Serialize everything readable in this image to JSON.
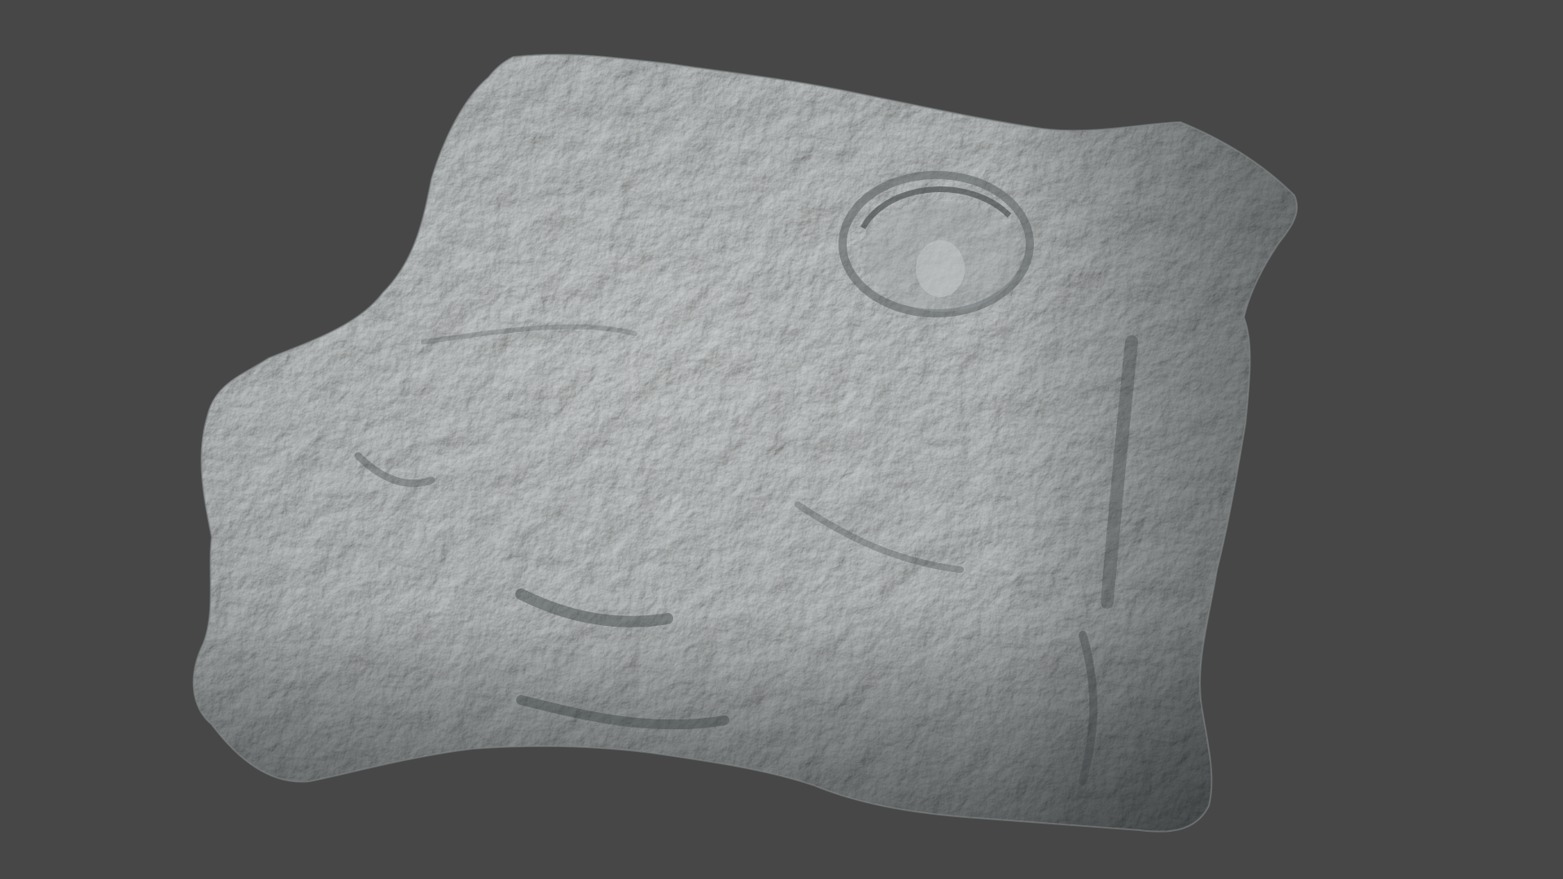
{
  "viewport": {
    "background_color": "#474747",
    "object_name": "rock-sculpt",
    "object_base_color": "#b4b8b8",
    "object_highlight_color": "#d3d6d6",
    "object_shadow_color": "#5f6466"
  }
}
